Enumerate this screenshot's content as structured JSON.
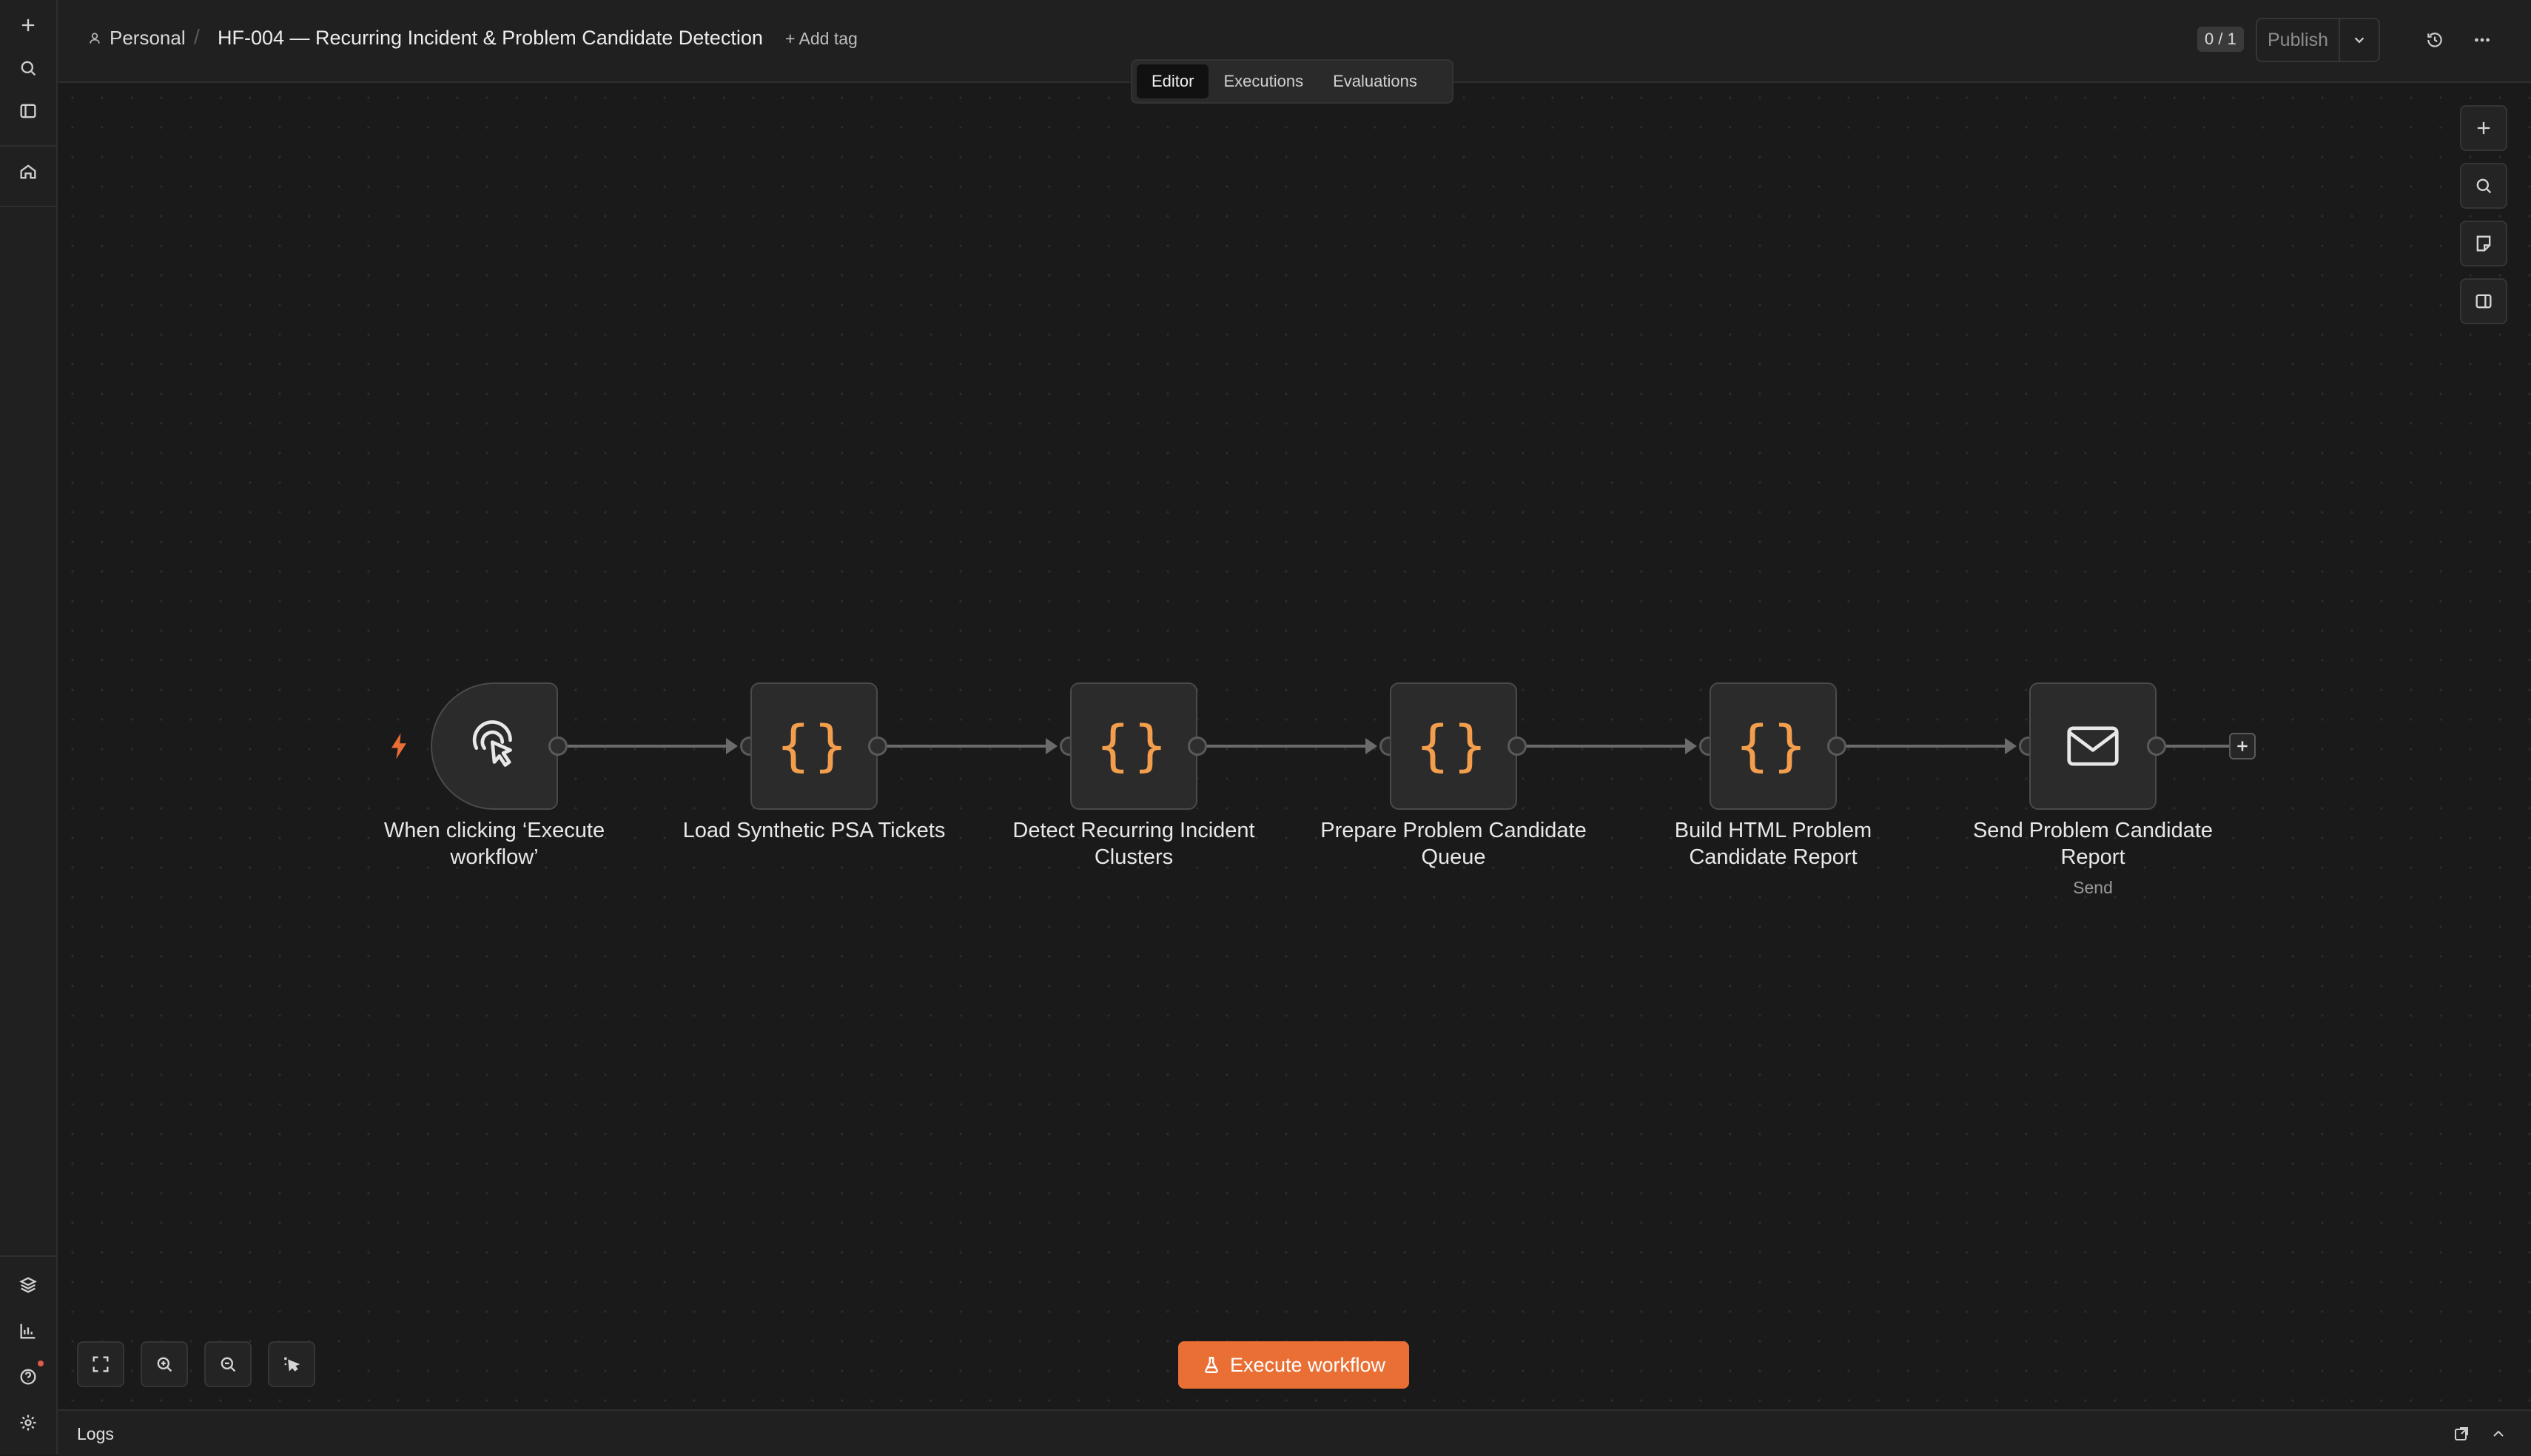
{
  "header": {
    "project": "Personal",
    "workflow_title": "HF-004 — Recurring Incident & Problem Candidate Detection",
    "add_tag": "+ Add tag",
    "counter": "0 / 1",
    "publish_label": "Publish"
  },
  "tabs": [
    {
      "label": "Editor",
      "active": true
    },
    {
      "label": "Executions",
      "active": false
    },
    {
      "label": "Evaluations",
      "active": false
    }
  ],
  "nodes": [
    {
      "label": "When clicking ‘Execute workflow’",
      "icon": "cursor-click-icon",
      "type": "trigger"
    },
    {
      "label": "Load Synthetic PSA Tickets",
      "icon": "braces-icon",
      "type": "code"
    },
    {
      "label": "Detect Recurring Incident Clusters",
      "icon": "braces-icon",
      "type": "code"
    },
    {
      "label": "Prepare Problem Candidate Queue",
      "icon": "braces-icon",
      "type": "code"
    },
    {
      "label": "Build HTML Problem Candidate Report",
      "icon": "braces-icon",
      "type": "code"
    },
    {
      "label": "Send Problem Candidate Report",
      "subtitle": "Send",
      "icon": "envelope-icon",
      "type": "email"
    }
  ],
  "execute_button": "Execute workflow",
  "logs": {
    "label": "Logs"
  },
  "colors": {
    "accent": "#ea6f35",
    "code_icon": "#f29e4c",
    "background": "#1a1a1a"
  }
}
